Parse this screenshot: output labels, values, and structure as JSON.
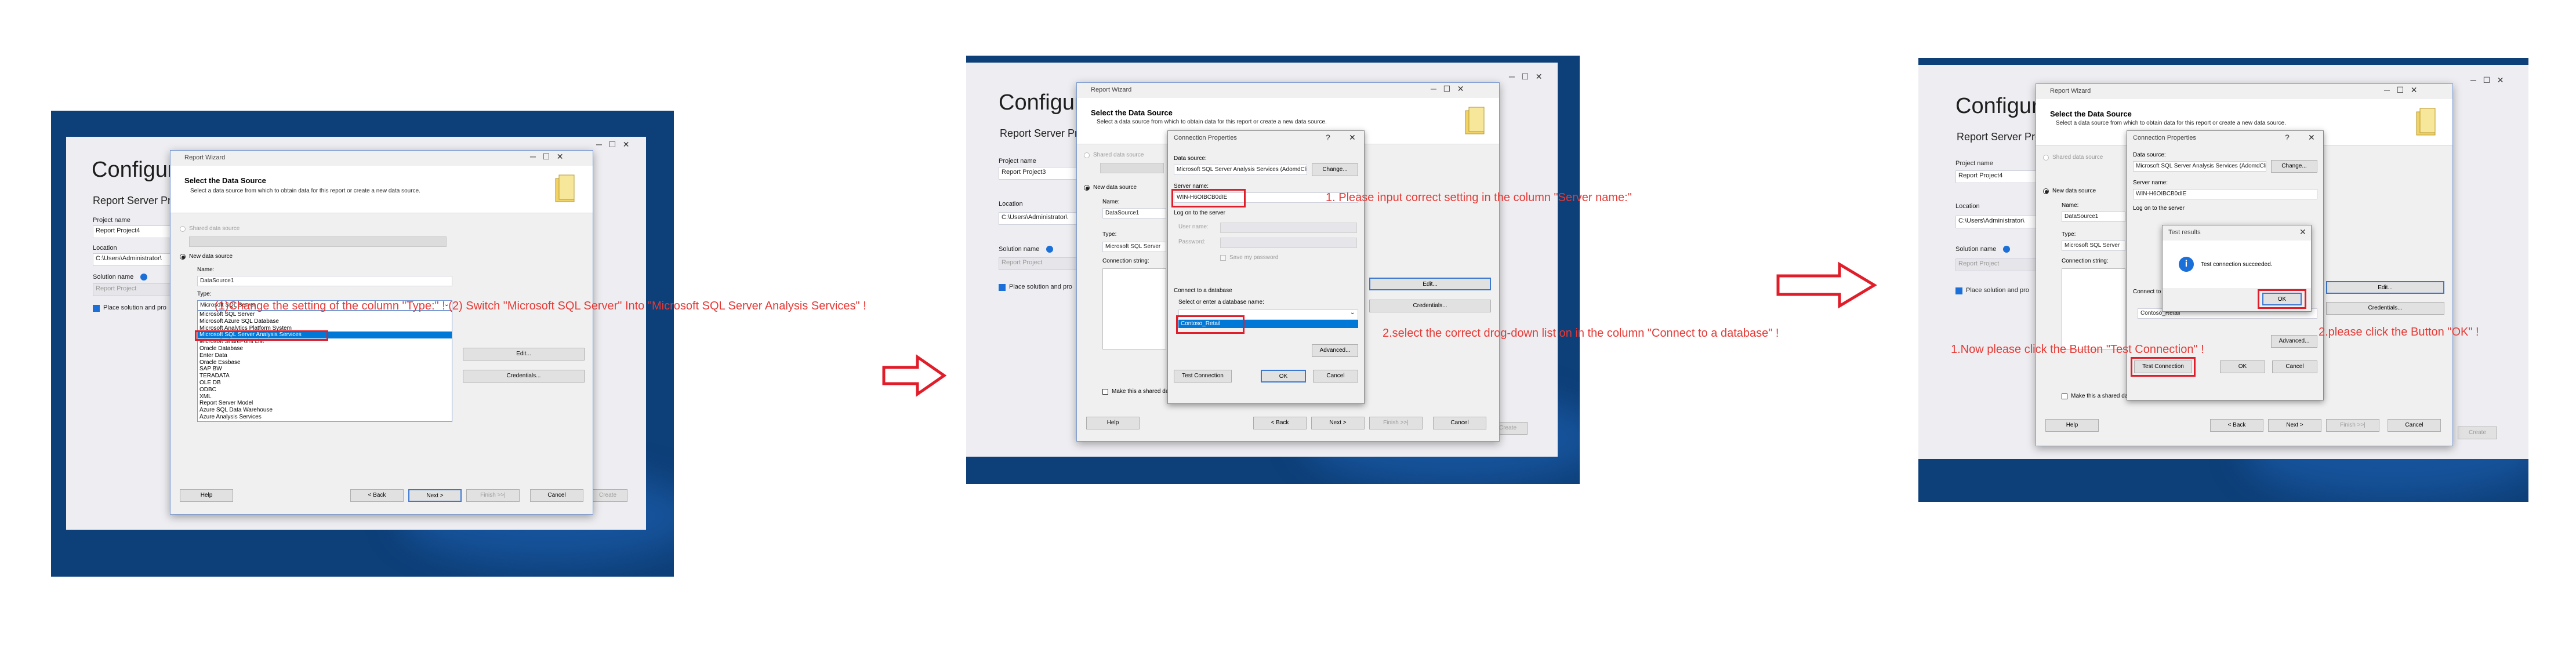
{
  "wizard": {
    "title": "Report Wizard",
    "header_title": "Select the Data Source",
    "header_desc": "Select a data source from which to obtain data for this report or create a new data source.",
    "shared_label": "Shared data source",
    "new_label": "New data source",
    "name_label": "Name:",
    "name_value": "DataSource1",
    "type_label": "Type:",
    "type_value": "Microsoft SQL Server",
    "conn_label": "Connection string:",
    "edit_btn": "Edit...",
    "cred_btn": "Credentials...",
    "make_shared": "Make this a shared data source",
    "help_btn": "Help",
    "back_btn": "< Back",
    "next_btn": "Next >",
    "finish_btn": "Finish >>|",
    "cancel_btn": "Cancel",
    "type_options": [
      "Microsoft SQL Server",
      "Microsoft Azure SQL Database",
      "Microsoft Analytics Platform System",
      "Microsoft SQL Server Analysis Services",
      "Microsoft SharePoint List",
      "Oracle Database",
      "Enter Data",
      "Oracle Essbase",
      "SAP BW",
      "TERADATA",
      "OLE DB",
      "ODBC",
      "XML",
      "Report Server Model",
      "Azure SQL Data Warehouse",
      "Azure Analysis Services"
    ]
  },
  "vs": {
    "title": "Configure",
    "subtitle": "Report Server Pro",
    "project_label": "Project name",
    "project_4": "Report Project4",
    "project_3": "Report Project3",
    "location_label": "Location",
    "location_value": "C:\\Users\\Administrator\\",
    "solution_label": "Solution name",
    "solution_value": "Report Project",
    "place_solution": "Place solution and pro",
    "create_btn": "Create"
  },
  "conn": {
    "title": "Connection Properties",
    "help": "?",
    "close": "✕",
    "ds_label": "Data source:",
    "ds_value": "Microsoft SQL Server Analysis Services (AdomdClient)",
    "change_btn": "Change...",
    "server_label": "Server name:",
    "server_value": "WIN-H6OIBCB0dIE",
    "logon_label": "Log on to the server",
    "user_label": "User name:",
    "pass_label": "Password:",
    "save_pass": "Save my password",
    "connect_label": "Connect to a database",
    "db_label": "Select or enter a database name:",
    "db_value": "Contoso_Retail",
    "advanced_btn": "Advanced...",
    "test_btn": "Test Connection",
    "ok_btn": "OK",
    "cancel_btn": "Cancel"
  },
  "test": {
    "title": "Test results",
    "message": "Test connection succeeded.",
    "ok_btn": "OK"
  },
  "annotations": {
    "step1": "(1)Change the setting of the column \"Type:\" ! (2) Switch \"Microsoft SQL Server\" Into \"Microsoft SQL Server Analysis Services\" !",
    "step2a": "1. Please input correct setting in the column \"Server name:\"",
    "step2b": "2.select the correct drog-down list on in the column \"Connect to a database\" !",
    "step3a": "1.Now please click the Button \"Test Connection\" !",
    "step3b": "2.please click the Button \"OK\" !"
  },
  "colors": {
    "desktop": "#0d3f78",
    "annotation": "#e53935",
    "arrow": "#e11d2a",
    "selection": "#0078d7"
  }
}
